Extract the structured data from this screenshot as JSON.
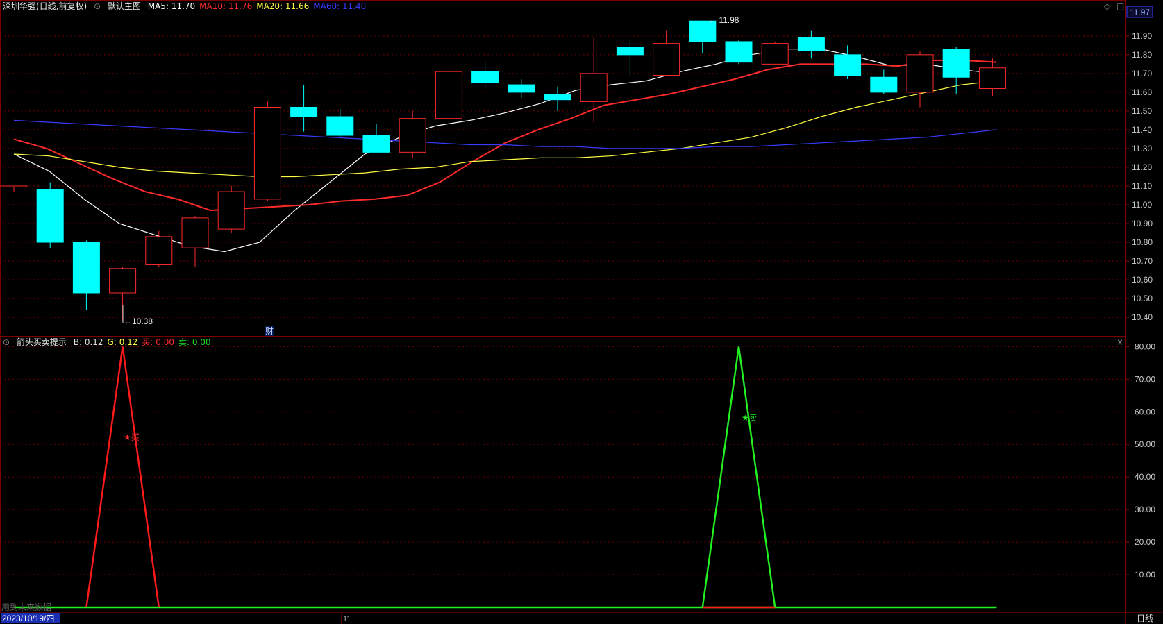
{
  "main_header": {
    "stock_title": "深圳华强(日线,前复权)",
    "chart_name": "默认主图",
    "ma": [
      {
        "label": "MA5:",
        "value": "11.70",
        "color": "#ffffff"
      },
      {
        "label": "MA10:",
        "value": "11.76",
        "color": "#ff2a2a"
      },
      {
        "label": "MA20:",
        "value": "11.66",
        "color": "#ffff44"
      },
      {
        "label": "MA60:",
        "value": "11.40",
        "color": "#3a3aff"
      }
    ]
  },
  "current_price_badge": "11.97",
  "high_marker": "11.98",
  "low_marker": "10.38",
  "fin_marker": "财",
  "sub_header": {
    "indicator_name": "箭头买卖提示",
    "items": [
      {
        "label": "B:",
        "value": "0.12",
        "color": "#e0e0e0"
      },
      {
        "label": "G:",
        "value": "0.12",
        "color": "#ffff44"
      },
      {
        "label": "买:",
        "value": "0.00",
        "color": "#ff2a2a"
      },
      {
        "label": "卖:",
        "value": "0.00",
        "color": "#22dd22"
      }
    ]
  },
  "signals": {
    "buy_label": "★买",
    "sell_label": "★卖"
  },
  "bottom": {
    "date_cursor": "2023/10/19/四",
    "month_label": "11",
    "period_label": "日线",
    "footer_note": "用到未来数据"
  },
  "colors": {
    "up": "#ff2a2a",
    "down": "#00ffff",
    "grid": "#6b0000",
    "buy_line": "#ff1a1a",
    "sell_line": "#22ee22"
  },
  "chart_data": [
    {
      "type": "candlestick",
      "title": "深圳华强(日线,前复权)",
      "ylim": [
        10.33,
        12.04
      ],
      "y_ticks": [
        "11.90",
        "11.80",
        "11.70",
        "11.60",
        "11.50",
        "11.40",
        "11.30",
        "11.20",
        "11.10",
        "11.00",
        "10.90",
        "10.80",
        "10.70",
        "10.60",
        "10.50",
        "10.40"
      ],
      "candles": [
        {
          "o": 11.1,
          "h": 11.1,
          "l": 11.07,
          "c": 11.1
        },
        {
          "o": 11.08,
          "h": 11.12,
          "l": 10.77,
          "c": 10.8
        },
        {
          "o": 10.8,
          "h": 10.81,
          "l": 10.44,
          "c": 10.53
        },
        {
          "o": 10.53,
          "h": 10.67,
          "l": 10.38,
          "c": 10.66
        },
        {
          "o": 10.68,
          "h": 10.86,
          "l": 10.67,
          "c": 10.83
        },
        {
          "o": 10.77,
          "h": 10.94,
          "l": 10.67,
          "c": 10.93
        },
        {
          "o": 10.87,
          "h": 11.1,
          "l": 10.85,
          "c": 11.07
        },
        {
          "o": 11.03,
          "h": 11.55,
          "l": 11.02,
          "c": 11.52
        },
        {
          "o": 11.52,
          "h": 11.64,
          "l": 11.39,
          "c": 11.47
        },
        {
          "o": 11.47,
          "h": 11.51,
          "l": 11.36,
          "c": 11.37
        },
        {
          "o": 11.37,
          "h": 11.43,
          "l": 11.28,
          "c": 11.28
        },
        {
          "o": 11.28,
          "h": 11.5,
          "l": 11.25,
          "c": 11.46
        },
        {
          "o": 11.46,
          "h": 11.72,
          "l": 11.45,
          "c": 11.71
        },
        {
          "o": 11.71,
          "h": 11.76,
          "l": 11.62,
          "c": 11.65
        },
        {
          "o": 11.64,
          "h": 11.67,
          "l": 11.57,
          "c": 11.6
        },
        {
          "o": 11.59,
          "h": 11.63,
          "l": 11.5,
          "c": 11.56
        },
        {
          "o": 11.55,
          "h": 11.89,
          "l": 11.44,
          "c": 11.7
        },
        {
          "o": 11.84,
          "h": 11.88,
          "l": 11.69,
          "c": 11.8
        },
        {
          "o": 11.69,
          "h": 11.93,
          "l": 11.69,
          "c": 11.86
        },
        {
          "o": 11.98,
          "h": 11.98,
          "l": 11.81,
          "c": 11.87
        },
        {
          "o": 11.87,
          "h": 11.88,
          "l": 11.75,
          "c": 11.76
        },
        {
          "o": 11.75,
          "h": 11.87,
          "l": 11.75,
          "c": 11.86
        },
        {
          "o": 11.89,
          "h": 11.93,
          "l": 11.78,
          "c": 11.82
        },
        {
          "o": 11.8,
          "h": 11.85,
          "l": 11.67,
          "c": 11.69
        },
        {
          "o": 11.68,
          "h": 11.72,
          "l": 11.59,
          "c": 11.6
        },
        {
          "o": 11.6,
          "h": 11.82,
          "l": 11.52,
          "c": 11.8
        },
        {
          "o": 11.83,
          "h": 11.84,
          "l": 11.59,
          "c": 11.68
        },
        {
          "o": 11.62,
          "h": 11.78,
          "l": 11.58,
          "c": 11.73
        }
      ],
      "series": [
        {
          "name": "MA5",
          "color": "#ffffff",
          "values": [
            11.27,
            11.18,
            11.03,
            10.9,
            10.84,
            10.78,
            10.75,
            10.8,
            10.97,
            11.12,
            11.27,
            11.36,
            11.42,
            11.45,
            11.49,
            11.54,
            11.61,
            11.64,
            11.66,
            11.71,
            11.75,
            11.8,
            11.83,
            11.83,
            11.79,
            11.74,
            11.75,
            11.72,
            11.7
          ]
        },
        {
          "name": "MA10",
          "color": "#ff2a2a",
          "values": [
            11.35,
            11.3,
            11.22,
            11.14,
            11.07,
            11.03,
            10.97,
            10.98,
            10.99,
            11.0,
            11.02,
            11.03,
            11.05,
            11.12,
            11.23,
            11.33,
            11.4,
            11.46,
            11.53,
            11.56,
            11.59,
            11.63,
            11.67,
            11.72,
            11.75,
            11.75,
            11.75,
            11.74,
            11.77,
            11.77,
            11.76
          ]
        },
        {
          "name": "MA20",
          "color": "#ffff44",
          "values": [
            11.27,
            11.26,
            11.23,
            11.2,
            11.18,
            11.17,
            11.16,
            11.15,
            11.15,
            11.16,
            11.17,
            11.19,
            11.2,
            11.23,
            11.24,
            11.25,
            11.25,
            11.26,
            11.28,
            11.3,
            11.33,
            11.36,
            11.41,
            11.47,
            11.52,
            11.56,
            11.6,
            11.64,
            11.66
          ]
        },
        {
          "name": "MA60",
          "color": "#3a3aff",
          "values": [
            11.45,
            11.44,
            11.43,
            11.42,
            11.41,
            11.4,
            11.39,
            11.38,
            11.37,
            11.36,
            11.35,
            11.34,
            11.33,
            11.32,
            11.32,
            11.31,
            11.31,
            11.3,
            11.3,
            11.3,
            11.31,
            11.31,
            11.32,
            11.33,
            11.34,
            11.35,
            11.36,
            11.38,
            11.4
          ]
        }
      ]
    },
    {
      "type": "line",
      "title": "箭头买卖提示",
      "ylim": [
        0,
        82
      ],
      "y_ticks": [
        "80.00",
        "70.00",
        "60.00",
        "50.00",
        "40.00",
        "30.00",
        "20.00",
        "10.00"
      ],
      "series": [
        {
          "name": "买",
          "color": "#ff1a1a",
          "points": [
            [
              2,
              0
            ],
            [
              3,
              80
            ],
            [
              4,
              0
            ]
          ]
        },
        {
          "name": "卖",
          "color": "#22ee22",
          "points": [
            [
              19,
              0
            ],
            [
              20,
              80
            ],
            [
              21,
              0
            ]
          ]
        }
      ]
    }
  ]
}
